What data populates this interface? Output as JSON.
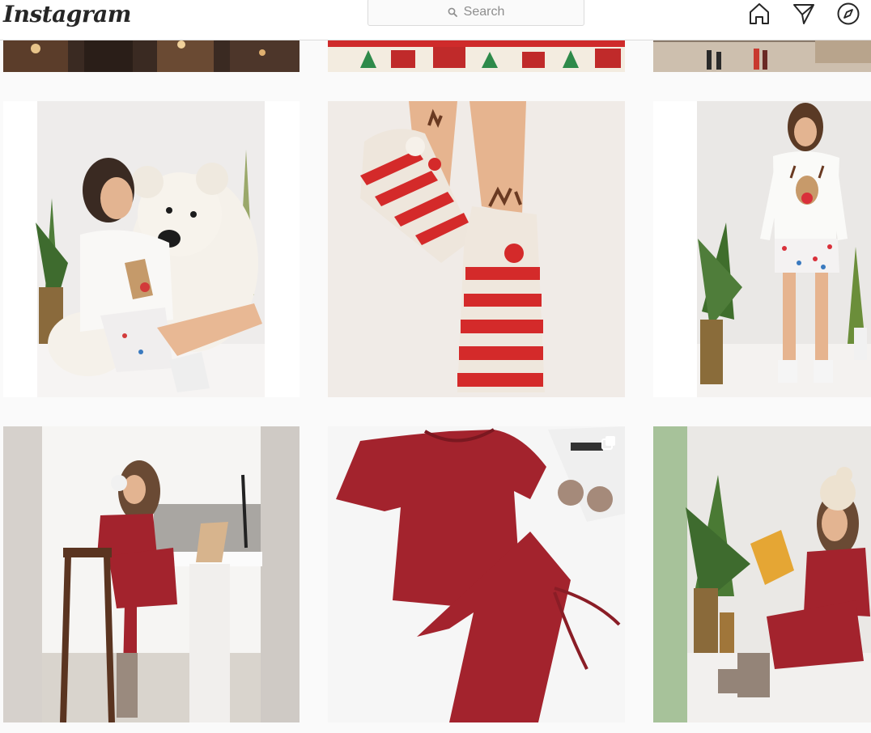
{
  "app": {
    "logo_text": "Instagram"
  },
  "search": {
    "placeholder": "Search",
    "icon": "search-icon"
  },
  "nav": {
    "icons": [
      "home-icon",
      "direct-message-icon",
      "explore-compass-icon"
    ]
  },
  "grid": {
    "rows": [
      [
        {
          "subject": "christmas-lights-street-night"
        },
        {
          "subject": "christmas-village-illustration"
        },
        {
          "subject": "people-walking-snowy-market"
        }
      ],
      [
        {
          "subject": "woman-reindeer-pajamas-with-teddy-bear"
        },
        {
          "subject": "red-white-striped-reindeer-fuzzy-socks"
        },
        {
          "subject": "woman-standing-reindeer-sweater-polka-dot-shorts"
        }
      ],
      [
        {
          "subject": "woman-red-loungewear-laptop-headphones"
        },
        {
          "subject": "red-ribbed-crop-top-and-pants-flatlay",
          "multi_post": true
        },
        {
          "subject": "woman-red-loungewear-reading-book-beanie"
        }
      ]
    ]
  },
  "colors": {
    "header_bg": "#ffffff",
    "page_bg": "#fafafa",
    "border": "#dbdbdb",
    "text_primary": "#262626",
    "placeholder": "#8e8e8e",
    "loungewear_red": "#a3232d"
  }
}
